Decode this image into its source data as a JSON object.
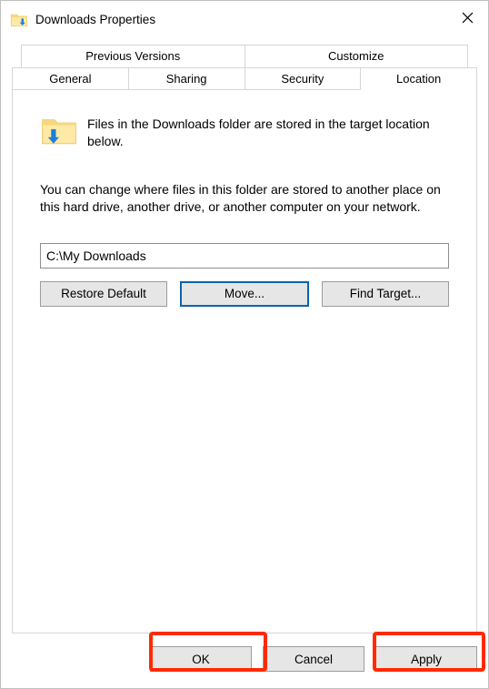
{
  "window": {
    "title": "Downloads Properties"
  },
  "tabs": {
    "row1": [
      {
        "label": "Previous Versions"
      },
      {
        "label": "Customize"
      }
    ],
    "row2": [
      {
        "label": "General"
      },
      {
        "label": "Sharing"
      },
      {
        "label": "Security"
      },
      {
        "label": "Location",
        "active": true
      }
    ]
  },
  "content": {
    "info": "Files in the Downloads folder are stored in the target location below.",
    "description": "You can change where files in this folder are stored to another place on this hard drive, another drive, or another computer on your network.",
    "path": "C:\\My Downloads",
    "buttons": {
      "restore": "Restore Default",
      "move": "Move...",
      "find": "Find Target..."
    }
  },
  "footer": {
    "ok": "OK",
    "cancel": "Cancel",
    "apply": "Apply"
  }
}
